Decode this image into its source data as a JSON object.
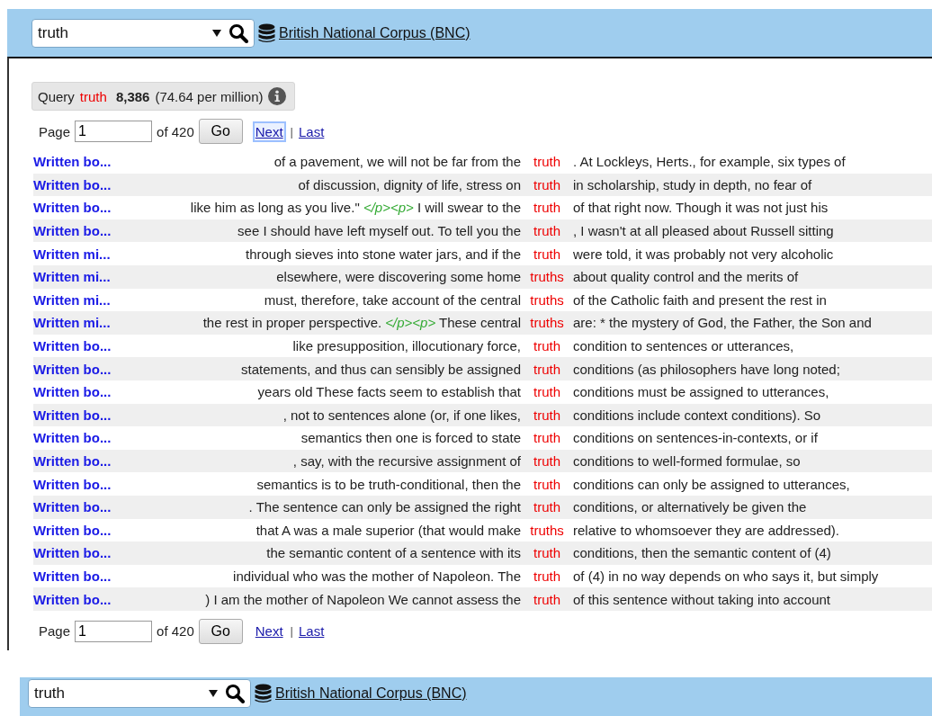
{
  "search_bars": [
    {
      "query": "truth",
      "corpus": "British National Corpus (BNC)"
    },
    {
      "query": "truth",
      "corpus": "British National Corpus (BNC)"
    }
  ],
  "query_summary": {
    "label": "Query",
    "term": "truth",
    "count": "8,386",
    "rate": "(74.64 per million)"
  },
  "pagers": [
    {
      "label": "Page",
      "value": "1",
      "of": "of 420",
      "go": "Go",
      "next": "Next",
      "separator": "|",
      "last": "Last",
      "next_focused": true
    },
    {
      "label": "Page",
      "value": "1",
      "of": "of 420",
      "go": "Go",
      "next": "Next",
      "separator": "|",
      "last": "Last",
      "next_focused": false
    }
  ],
  "rows": [
    {
      "source": "Written bo...",
      "left": "of a pavement, we will not be far from the",
      "keyword": "truth",
      "right": ". At Lockleys, Herts., for example, six types of"
    },
    {
      "source": "Written bo...",
      "left": "of discussion, dignity of life, stress on",
      "keyword": "truth",
      "right": "in scholarship, study in depth, no fear of"
    },
    {
      "source": "Written bo...",
      "left": "like him as long as you live.\" *</p><p>* I will swear to the",
      "keyword": "truth",
      "right": "of that right now. Though it was not just his"
    },
    {
      "source": "Written bo...",
      "left": "see I should have left myself out. To tell you the",
      "keyword": "truth",
      "right": ", I wasn't at all pleased about Russell sitting"
    },
    {
      "source": "Written mi...",
      "left": "through sieves into stone water jars, and if the",
      "keyword": "truth",
      "right": "were told, it was probably not very alcoholic"
    },
    {
      "source": "Written mi...",
      "left": "elsewhere, were discovering some home",
      "keyword": "truths",
      "right": "about quality control and the merits of"
    },
    {
      "source": "Written mi...",
      "left": "must, therefore, take account of the central",
      "keyword": "truths",
      "right": "of the Catholic faith and present the rest in"
    },
    {
      "source": "Written mi...",
      "left": "the rest in proper perspective. *</p><p>* These central",
      "keyword": "truths",
      "right": "are: * the mystery of God, the Father, the Son and"
    },
    {
      "source": "Written bo...",
      "left": "like presupposition, illocutionary force,",
      "keyword": "truth",
      "right": "condition to sentences or utterances,"
    },
    {
      "source": "Written bo...",
      "left": "statements, and thus can sensibly be assigned",
      "keyword": "truth",
      "right": "conditions (as philosophers have long noted;"
    },
    {
      "source": "Written bo...",
      "left": "years old These facts seem to establish that",
      "keyword": "truth",
      "right": "conditions must be assigned to utterances,"
    },
    {
      "source": "Written bo...",
      "left": ", not to sentences alone (or, if one likes,",
      "keyword": "truth",
      "right": "conditions include context conditions). So"
    },
    {
      "source": "Written bo...",
      "left": "semantics then one is forced to state",
      "keyword": "truth",
      "right": "conditions on sentences-in-contexts, or if"
    },
    {
      "source": "Written bo...",
      "left": ", say, with the recursive assignment of",
      "keyword": "truth",
      "right": "conditions to well-formed formulae, so"
    },
    {
      "source": "Written bo...",
      "left": "semantics is to be truth-conditional, then the",
      "keyword": "truth",
      "right": "conditions can only be assigned to utterances,"
    },
    {
      "source": "Written bo...",
      "left": ". The sentence can only be assigned the right",
      "keyword": "truth",
      "right": "conditions, or alternatively be given the"
    },
    {
      "source": "Written bo...",
      "left": "that A was a male superior (that would make",
      "keyword": "truths",
      "right": "relative to whomsoever they are addressed)."
    },
    {
      "source": "Written bo...",
      "left": "the semantic content of a sentence with its",
      "keyword": "truth",
      "right": "conditions, then the semantic content of (4)"
    },
    {
      "source": "Written bo...",
      "left": "individual who was the mother of Napoleon. The",
      "keyword": "truth",
      "right": "of (4) in no way depends on who says it, but simply"
    },
    {
      "source": "Written bo...",
      "left": ") I am the mother of Napoleon We cannot assess the",
      "keyword": "truth",
      "right": "of this sentence without taking into account"
    }
  ]
}
